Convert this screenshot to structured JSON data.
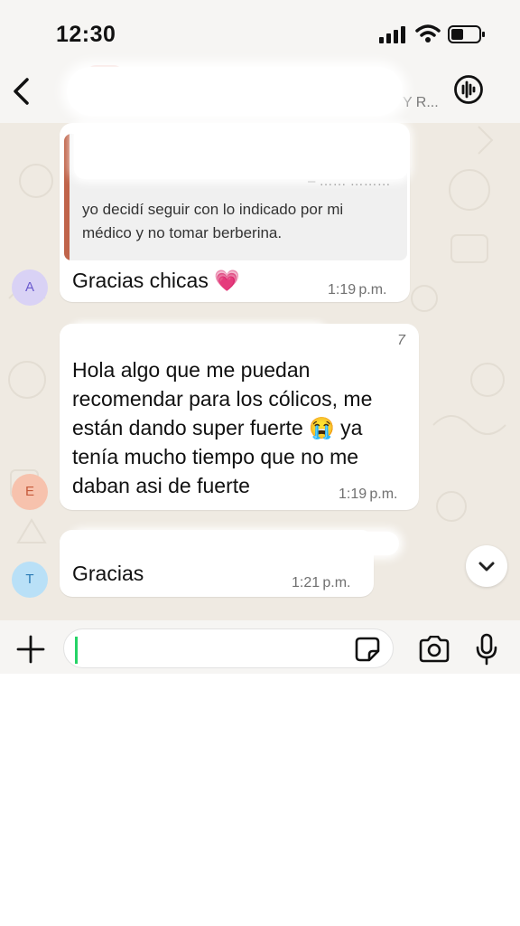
{
  "status_bar": {
    "time": "12:30"
  },
  "header": {
    "members_snippet": "… …, … … Y R..."
  },
  "colors": {
    "wallpaper": "#efeae2",
    "quote_bar": "#c0644a",
    "accent": "#25d366",
    "avatar_a": "#d9d2f5",
    "avatar_e": "#f7c2ad",
    "avatar_t": "#b9e0f7"
  },
  "messages": [
    {
      "sender_initial": "A",
      "quote": {
        "lines": [
          "yo decidí seguir con lo indicado por mi",
          "médico y no tomar berberina."
        ],
        "partial_number": "– …… ………"
      },
      "text": "Gracias chicas 💗",
      "time": "1:19 p.m."
    },
    {
      "sender_initial": "E",
      "header_fragment": "7",
      "lines": [
        "Hola algo que me puedan",
        "recomendar para los cólicos, me",
        "están dando super fuerte 😭 ya",
        "tenía mucho tiempo que no me",
        "daban asi de fuerte"
      ],
      "time": "1:19 p.m."
    },
    {
      "sender_initial": "T",
      "text": "Gracias",
      "time": "1:21 p.m."
    }
  ],
  "icons": [
    "back-arrow-icon",
    "audio-call-icon",
    "scroll-down-icon",
    "plus-icon",
    "sticker-icon",
    "camera-icon",
    "microphone-icon"
  ]
}
